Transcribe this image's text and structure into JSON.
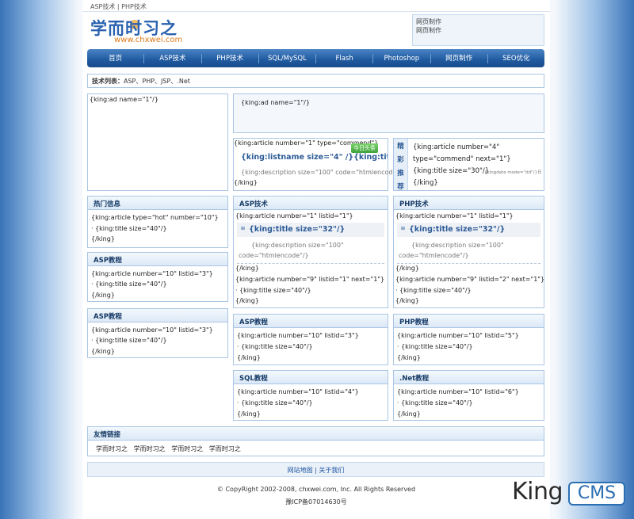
{
  "top_links": [
    "ASP技术",
    "PHP技术"
  ],
  "top_sep": "|",
  "logo": {
    "title": "学而时习之",
    "url": "www.chxwei.com"
  },
  "header_links": [
    "网页制作",
    "网页制作"
  ],
  "nav": [
    "首页",
    "ASP技术",
    "PHP技术",
    "SQL/MySQL",
    "Flash",
    "Photoshop",
    "网页制作",
    "SEO优化"
  ],
  "crumb": {
    "label": "技术列表：",
    "value": "ASP、PHP、JSP、.Net"
  },
  "left_ad": "{king:ad name=\"1\"/}",
  "right_ad": "{king:ad name=\"1\"/}",
  "commend": {
    "open": "{king:article number=\"1\" type=\"commend\"}",
    "tag": "今日头条",
    "title": "{king:listname size=\"4\" /}{king:title size=\"2",
    "desc": "{king:description size=\"100\" code=\"htmlencode\"/}",
    "close": "{/king}"
  },
  "featured": {
    "side_chars": [
      "精",
      "彩",
      "推",
      "荐"
    ],
    "line1": "{king:article number=\"4\"",
    "line2": "type=\"commend\" next=\"1\"}",
    "line3": "{king:title size=\"30\"/}",
    "line3_small": "{kingdate mode=\"dd\"/}日",
    "line4": "{/king}"
  },
  "hot": {
    "title": "热门信息",
    "l1": "{king:article type=\"hot\" number=\"10\"}",
    "l2": "· {king:title size=\"40\"/}",
    "l3": "{/king}"
  },
  "asp_left_1": {
    "title": "ASP教程",
    "l1": "{king:article number=\"10\" listid=\"3\"}",
    "l2": "· {king:title size=\"40\"/}",
    "l3": "{/king}"
  },
  "asp_left_2": {
    "title": "ASP教程",
    "l1": "{king:article number=\"10\" listid=\"3\"}",
    "l2": "· {king:title size=\"40\"/}",
    "l3": "{/king}"
  },
  "asp_tech": {
    "title": "ASP技术",
    "l1": "{king:article number=\"1\" listid=\"1\"}",
    "bigtitle": "{king:title size=\"32\"/}",
    "desc1": "{king:description size=\"100\"",
    "desc2": "code=\"htmlencode\"/}",
    "l4": "{/king}",
    "l5": "{king:article number=\"9\" listid=\"1\" next=\"1\"}",
    "l6": "· {king:title size=\"40\"/}",
    "l7": "{/king}"
  },
  "php_tech": {
    "title": "PHP技术",
    "l1": "{king:article number=\"1\" listid=\"1\"}",
    "bigtitle": "{king:title size=\"32\"/}",
    "desc1": "{king:description size=\"100\"",
    "desc2": "code=\"htmlencode\"/}",
    "l4": "{/king}",
    "l5": "{king:article number=\"9\" listid=\"2\" next=\"1\"}",
    "l6": "· {king:title size=\"40\"/}",
    "l7": "{/king}"
  },
  "asp_mid": {
    "title": "ASP教程",
    "l1": "{king:article number=\"10\" listid=\"3\"}",
    "l2": "· {king:title size=\"40\"/}",
    "l3": "{/king}"
  },
  "php_mid": {
    "title": "PHP教程",
    "l1": "{king:article number=\"10\" listid=\"5\"}",
    "l2": "· {king:title size=\"40\"/}",
    "l3": "{/king}"
  },
  "sql_mid": {
    "title": "SQL教程",
    "l1": "{king:article number=\"10\" listid=\"4\"}",
    "l2": "· {king:title size=\"40\"/}",
    "l3": "{/king}"
  },
  "net_mid": {
    "title": ".Net教程",
    "l1": "{king:article number=\"10\" listid=\"6\"}",
    "l2": "· {king:title size=\"40\"/}",
    "l3": "{/king}"
  },
  "friends": {
    "title": "友情链接",
    "links": [
      "学而时习之",
      "学而时习之",
      "学而时习之",
      "学而时习之"
    ]
  },
  "footer": {
    "sitemap": "网站地图",
    "sep": "|",
    "about": "关于我们",
    "copyright": "© CopyRight 2002-2008, chxwei.com, Inc. All Rights Reserved",
    "icp": "豫ICP备07014630号"
  },
  "brand": {
    "king": "King",
    "cms": "CMS"
  }
}
